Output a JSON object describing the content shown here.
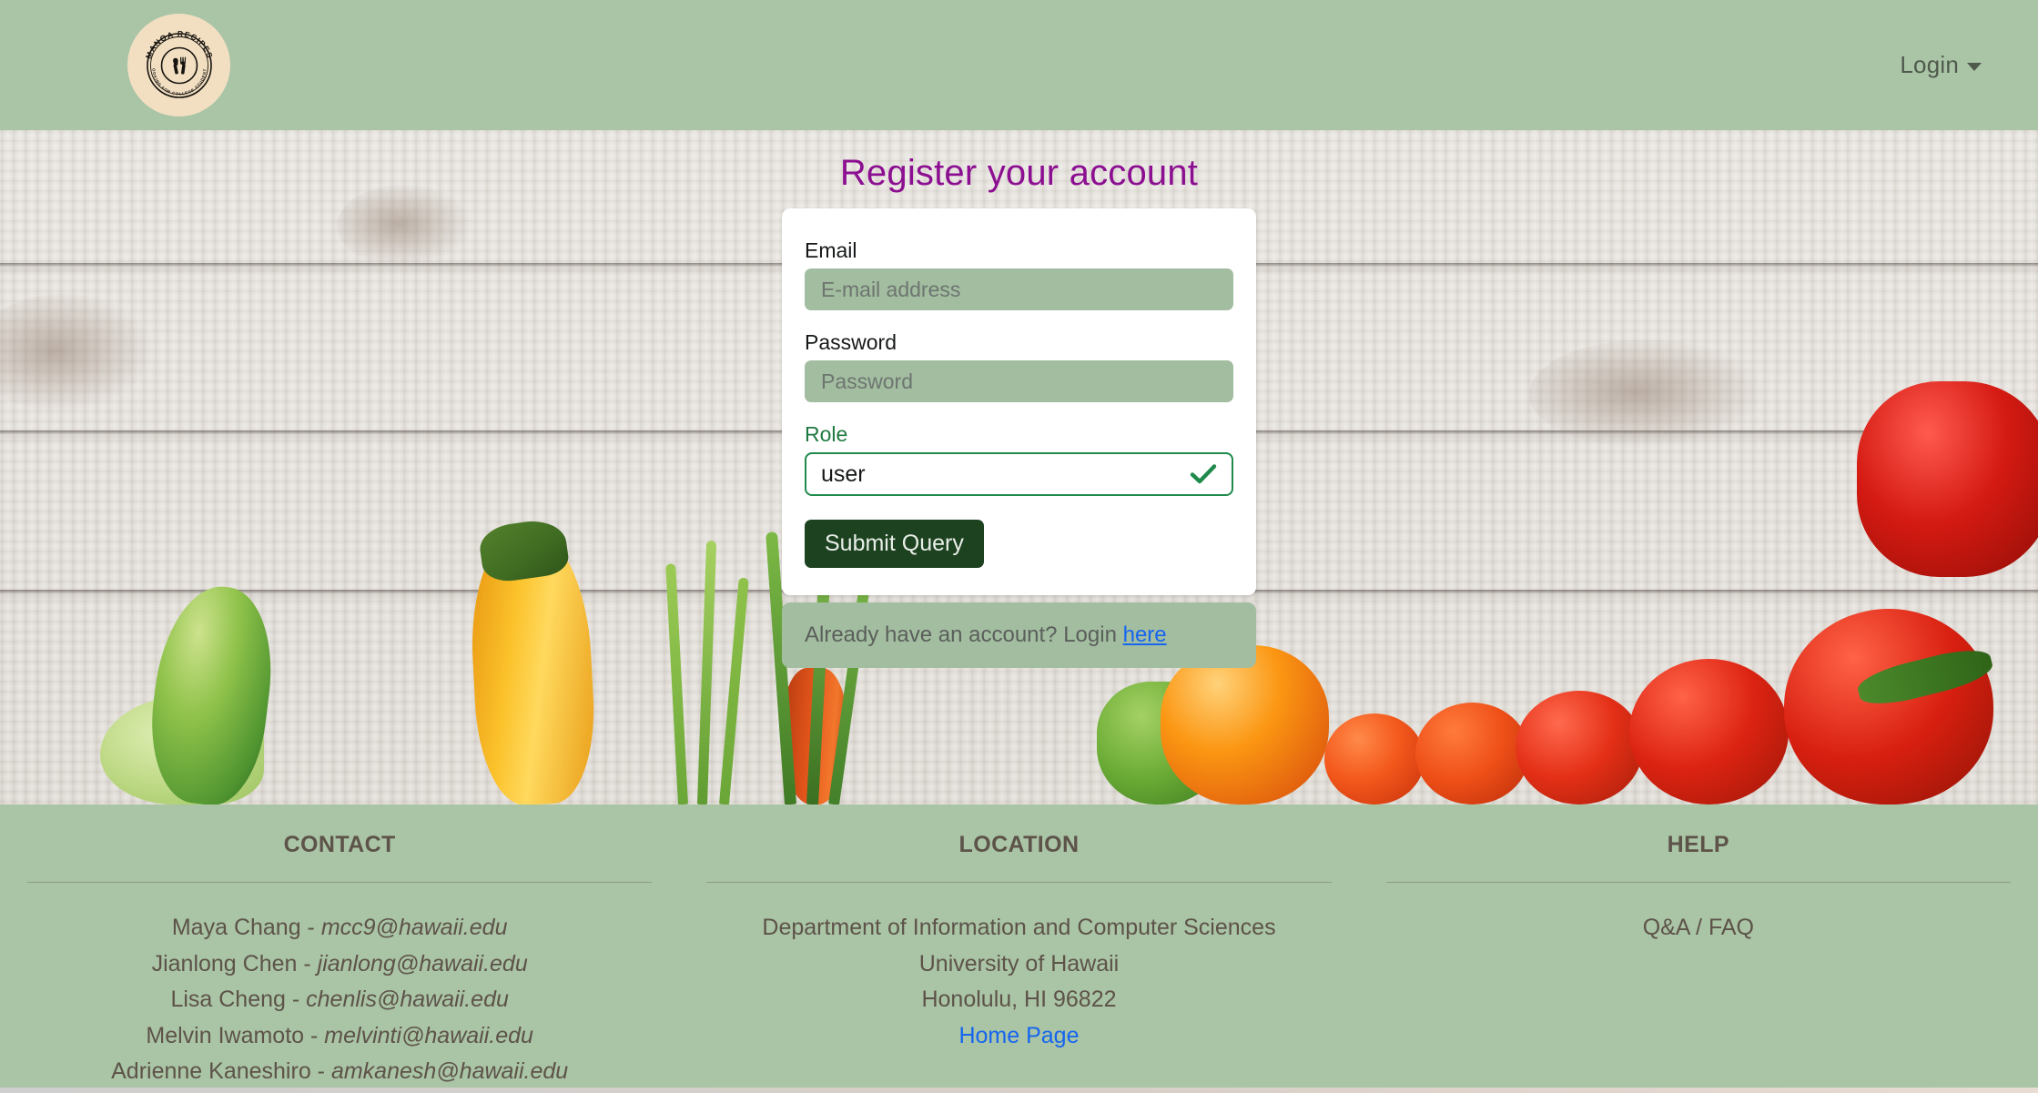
{
  "navbar": {
    "brand": {
      "icon": "manoa-recipes-badge-logo",
      "outer_text": "MANOA RECIPES",
      "inner_text": "COOKING FOR COLLEGE STUDENTS"
    },
    "login_label": "Login",
    "login_caret_icon": "chevron-down-icon"
  },
  "hero": {
    "title": "Register your account",
    "form": {
      "email": {
        "label": "Email",
        "placeholder": "E-mail address",
        "value": ""
      },
      "password": {
        "label": "Password",
        "placeholder": "Password",
        "value": ""
      },
      "role": {
        "label": "Role",
        "value": "user",
        "valid_icon": "check-icon"
      },
      "submit_label": "Submit Query"
    },
    "login_hint": {
      "text": "Already have an account? Login ",
      "link_label": "here"
    }
  },
  "footer": {
    "columns": [
      {
        "heading": "CONTACT",
        "entries": [
          {
            "name": "Maya Chang - ",
            "email": "mcc9@hawaii.edu"
          },
          {
            "name": "Jianlong Chen - ",
            "email": "jianlong@hawaii.edu"
          },
          {
            "name": "Lisa Cheng - ",
            "email": "chenlis@hawaii.edu"
          },
          {
            "name": "Melvin Iwamoto - ",
            "email": "melvinti@hawaii.edu"
          },
          {
            "name": "Adrienne Kaneshiro - ",
            "email": "amkanesh@hawaii.edu"
          }
        ]
      },
      {
        "heading": "LOCATION",
        "lines": [
          "Department of Information and Computer Sciences",
          "University of Hawaii",
          "Honolulu, HI 96822"
        ],
        "link_label": "Home Page"
      },
      {
        "heading": "HELP",
        "lines": [
          "Q&A / FAQ"
        ]
      }
    ]
  },
  "colors": {
    "brand_green": "#aac4a6",
    "input_green": "#a3bda0",
    "title_purple": "#8c0f91",
    "submit_green": "#1d4220",
    "valid_green": "#1f8a4c",
    "link_blue": "#1565f0",
    "logo_cream": "#f2dfc2",
    "footer_text": "#5d5349"
  }
}
